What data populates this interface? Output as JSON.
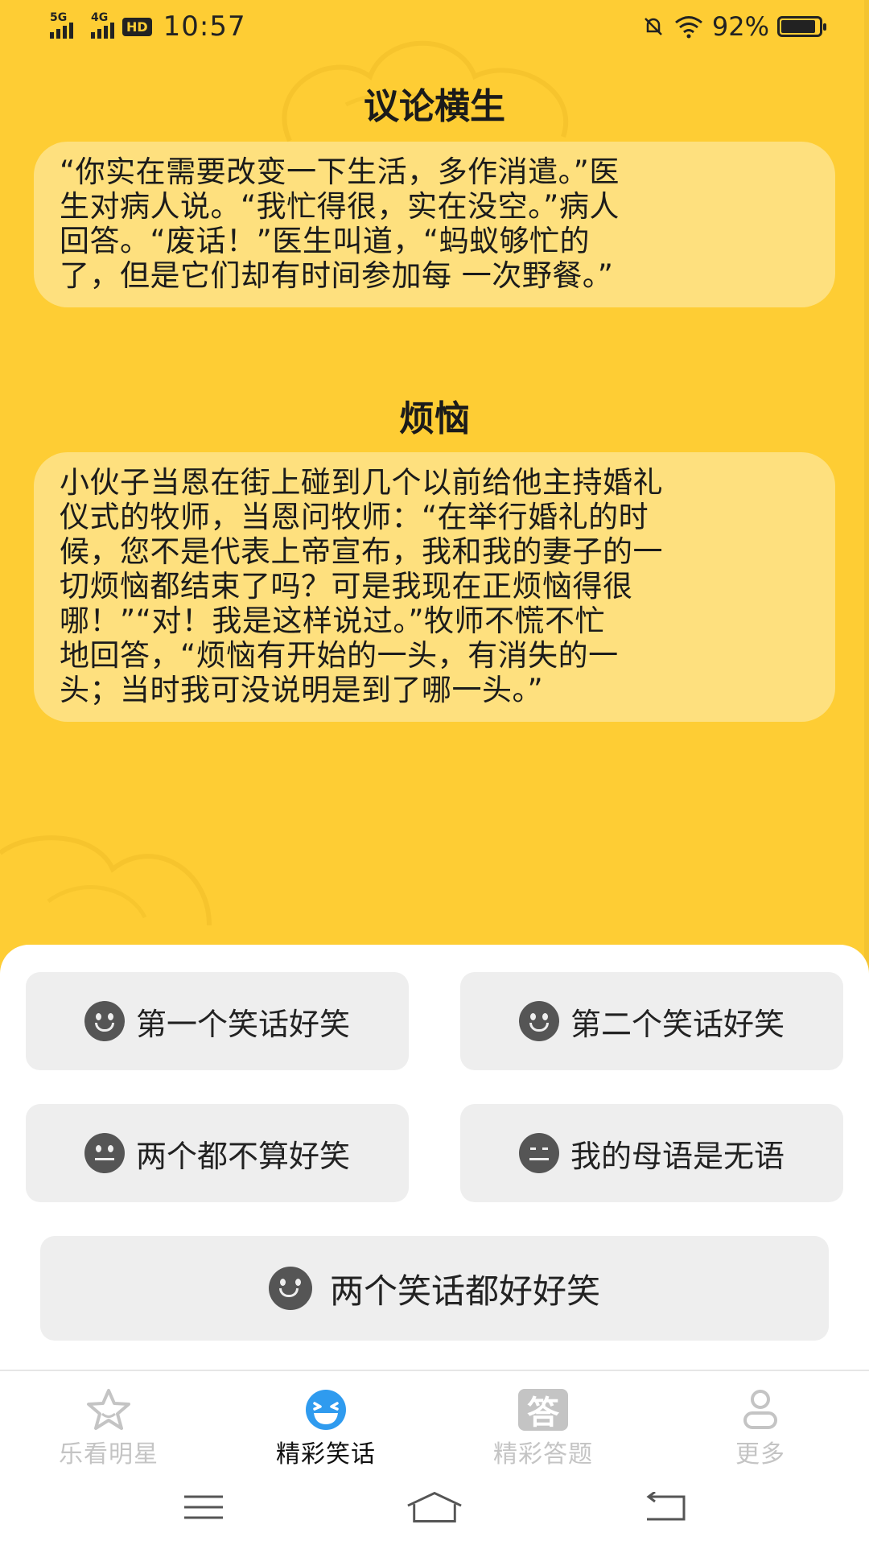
{
  "status_bar": {
    "sim1": "5G",
    "sim2": "4G",
    "hd": "HD",
    "time": "10:57",
    "battery": "92%",
    "battery_level": 0.92
  },
  "jokes": [
    {
      "title": "议论横生",
      "lines": [
        "“你实在需要改变一下生活，多作消遣。”医",
        "生对病人说。“我忙得很，实在没空。”病人",
        "回答。“废话！”医生叫道，“蚂蚁够忙的",
        "了，但是它们却有时间参加每 一次野餐。”"
      ]
    },
    {
      "title": "烦恼",
      "lines": [
        "小伙子当恩在街上碰到几个以前给他主持婚礼",
        "仪式的牧师，当恩问牧师：“在举行婚礼的时",
        "候，您不是代表上帝宣布，我和我的妻子的一",
        "切烦恼都结束了吗？可是我现在正烦恼得很",
        "哪！”“对！我是这样说过。”牧师不慌不忙",
        "地回答，“烦恼有开始的一头，有消失的一",
        "头；当时我可没说明是到了哪一头。”"
      ]
    }
  ],
  "choices": {
    "first_funny": "第一个笑话好笑",
    "second_funny": "第二个笑话好笑",
    "neither_funny": "两个都不算好笑",
    "speechless": "我的母语是无语",
    "both_funny": "两个笑话都好好笑"
  },
  "tabs": [
    {
      "label": "乐看明星",
      "icon": "star-icon",
      "active": false
    },
    {
      "label": "精彩笑话",
      "icon": "laughing-face-icon",
      "active": true
    },
    {
      "label": "精彩答题",
      "icon": "answer-icon",
      "active": false,
      "icon_text": "答"
    },
    {
      "label": "更多",
      "icon": "person-icon",
      "active": false
    }
  ],
  "colors": {
    "background": "#FECD34",
    "card": "#FEE07E",
    "accent": "#2F9BEF",
    "inactive": "#C4C4C4"
  }
}
